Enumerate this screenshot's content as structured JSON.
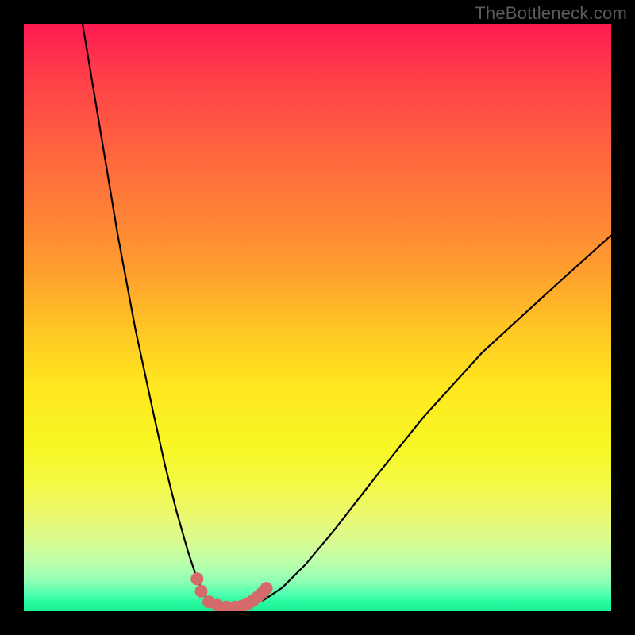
{
  "watermark": "TheBottleneck.com",
  "chart_data": {
    "type": "line",
    "title": "",
    "xlabel": "",
    "ylabel": "",
    "xlim": [
      0,
      100
    ],
    "ylim": [
      0,
      100
    ],
    "grid": false,
    "legend": false,
    "background_gradient": {
      "top": "#ff1a52",
      "mid": "#ffe81e",
      "bottom": "#1af096"
    },
    "series": [
      {
        "name": "bottleneck-curve",
        "color": "#000000",
        "x": [
          10,
          13,
          16,
          19,
          22,
          24,
          26,
          28,
          29.5,
          30.5,
          31.5,
          33,
          35,
          37,
          39,
          41,
          44,
          48,
          53,
          60,
          68,
          78,
          90,
          100
        ],
        "y": [
          100,
          82,
          64,
          48,
          34,
          25,
          17,
          10,
          5.5,
          3.2,
          1.8,
          1.0,
          0.6,
          0.6,
          1.0,
          2.0,
          4.0,
          8.0,
          14,
          23,
          33,
          44,
          55,
          64
        ]
      },
      {
        "name": "highlight-dots",
        "color": "#d46a6a",
        "type": "scatter",
        "x": [
          29.5,
          30.2,
          31.5,
          33.0,
          34.5,
          36.0,
          37.2,
          38.2,
          39.0,
          39.8,
          40.6,
          41.3
        ],
        "y": [
          5.5,
          3.4,
          1.6,
          1.0,
          0.7,
          0.7,
          0.9,
          1.3,
          1.8,
          2.4,
          3.1,
          3.9
        ]
      }
    ],
    "annotations": []
  },
  "colors": {
    "curve": "#000000",
    "dots": "#d46a6a",
    "frame": "#000000",
    "watermark": "#5b5b5b"
  }
}
